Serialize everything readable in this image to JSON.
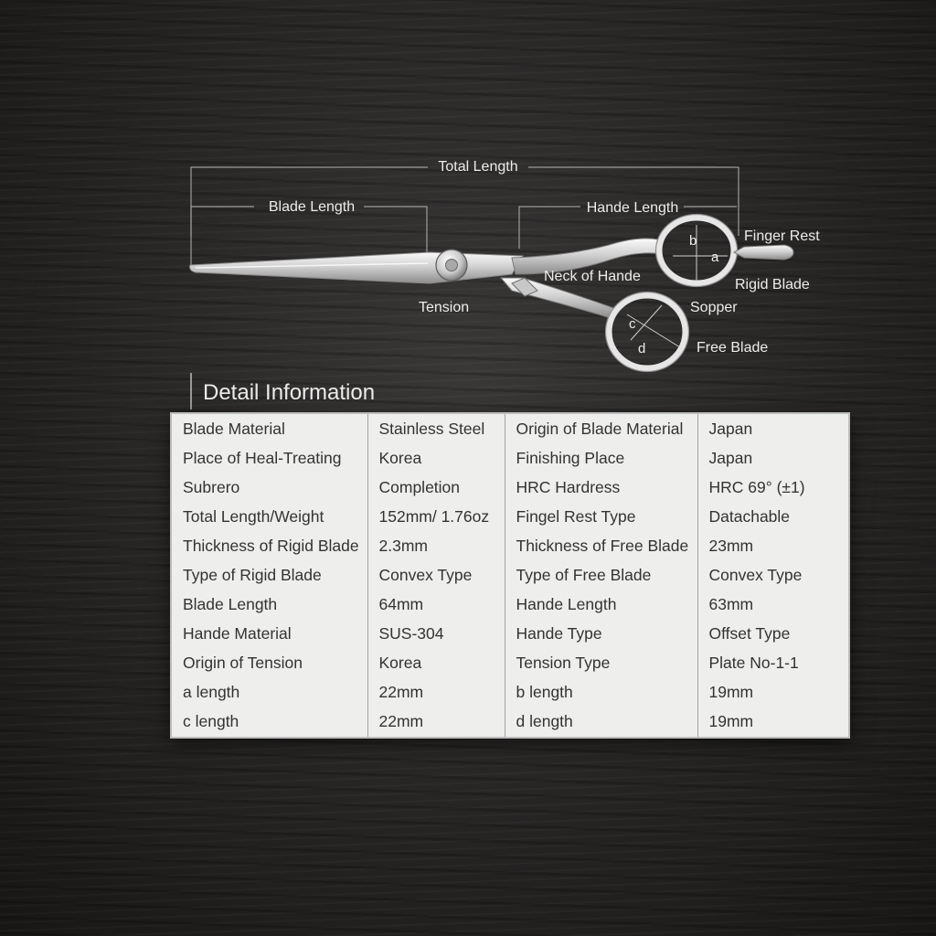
{
  "diagram": {
    "labels": {
      "total_length": "Total Length",
      "blade_length": "Blade Length",
      "handle_length": "Hande Length",
      "finger_rest": "Finger Rest",
      "rigid_blade": "Rigid Blade",
      "neck_of_handle": "Neck of Hande",
      "tension": "Tension",
      "stopper": "Sopper",
      "free_blade": "Free Blade",
      "a": "a",
      "b": "b",
      "c": "c",
      "d": "d"
    }
  },
  "detail": {
    "title": "Detail Information",
    "rows": [
      [
        "Blade Material",
        "Stainless Steel",
        "Origin of Blade Material",
        "Japan"
      ],
      [
        "Place of Heal-Treating",
        "Korea",
        "Finishing Place",
        "Japan"
      ],
      [
        "Subrero",
        "Completion",
        "HRC Hardress",
        "HRC 69° (±1)"
      ],
      [
        "Total Length/Weight",
        "152mm/ 1.76oz",
        "Fingel Rest Type",
        "Datachable"
      ],
      [
        "Thickness of Rigid Blade",
        "2.3mm",
        "Thickness of Free Blade",
        "23mm"
      ],
      [
        "Type of Rigid Blade",
        "Convex Type",
        "Type of Free Blade",
        "Convex Type"
      ],
      [
        "Blade Length",
        "64mm",
        "Hande Length",
        "63mm"
      ],
      [
        "Hande Material",
        "SUS-304",
        "Hande Type",
        "Offset Type"
      ],
      [
        "Origin of Tension",
        "Korea",
        "Tension Type",
        "Plate No-1-1"
      ],
      [
        "a length",
        "22mm",
        "b length",
        "19mm"
      ],
      [
        "c length",
        "22mm",
        "d length",
        "19mm"
      ]
    ]
  }
}
